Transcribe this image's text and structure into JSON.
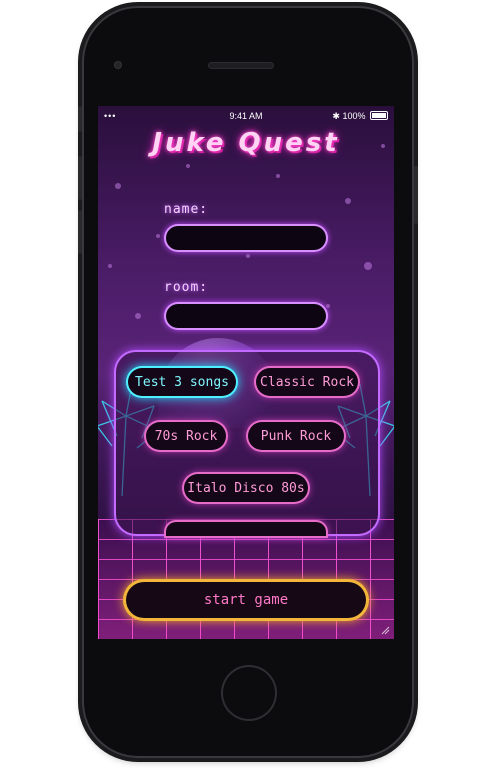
{
  "status_bar": {
    "signal": "•••",
    "time": "9:41 AM",
    "battery": "100%"
  },
  "app": {
    "title": "Juke Quest"
  },
  "form": {
    "name_label": "name:",
    "name_value": "",
    "room_label": "room:",
    "room_value": ""
  },
  "genres": [
    {
      "label": "Test 3 songs",
      "selected": true
    },
    {
      "label": "Classic Rock",
      "selected": false
    },
    {
      "label": "70s Rock",
      "selected": false
    },
    {
      "label": "Punk Rock",
      "selected": false
    },
    {
      "label": "Italo Disco 80s",
      "selected": false
    },
    {
      "label": "",
      "selected": false
    }
  ],
  "actions": {
    "start_label": "start game"
  },
  "colors": {
    "accent_pink": "#e56cc8",
    "accent_cyan": "#4ff0ff",
    "accent_gold": "#f2b63a",
    "field_glow": "#d98fff"
  }
}
